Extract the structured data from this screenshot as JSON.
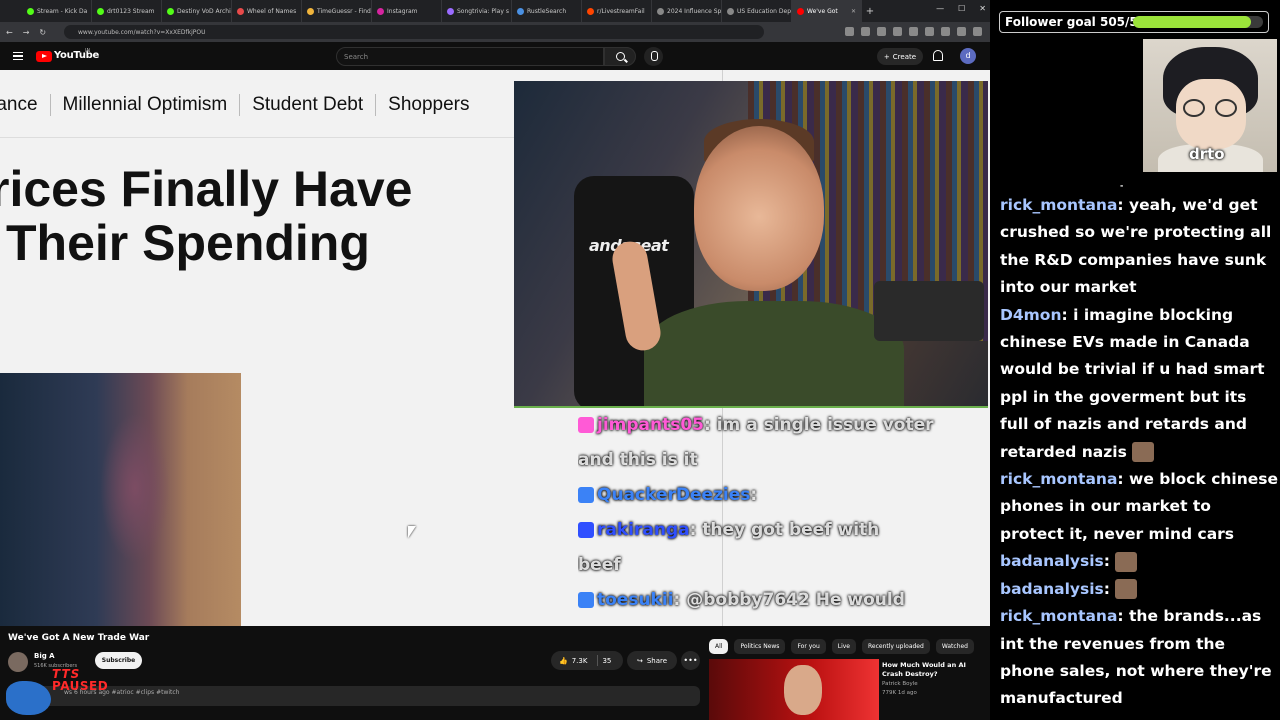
{
  "browser": {
    "tabs": [
      {
        "label": "Stream - Kick Da",
        "color": "#53fc18"
      },
      {
        "label": "drt0123 Stream",
        "color": "#53fc18"
      },
      {
        "label": "Destiny VoD Archi",
        "color": "#53fc18"
      },
      {
        "label": "Wheel of Names",
        "color": "#e84a4a"
      },
      {
        "label": "TimeGuessr - Find",
        "color": "#f0b43c"
      },
      {
        "label": "Instagram",
        "color": "#d6249f"
      },
      {
        "label": "Songtrivia: Play s",
        "color": "#9a6bff"
      },
      {
        "label": "RustleSearch",
        "color": "#4a90e2"
      },
      {
        "label": "r/LivestreamFail",
        "color": "#ff4500"
      },
      {
        "label": "2024 Influence Spendi",
        "color": "#888888"
      },
      {
        "label": "US Education Dep",
        "color": "#888888"
      },
      {
        "label": "We've Got",
        "color": "#ff0000",
        "active": true
      }
    ],
    "url": "www.youtube.com/watch?v=XxXEDfkjPOU"
  },
  "youtube": {
    "logo": "YouTube",
    "logo_sup": "IN",
    "search_placeholder": "Search",
    "create_label": "Create",
    "avatar_letter": "d"
  },
  "video": {
    "nav": [
      "rance",
      "Millennial Optimism",
      "Student Debt",
      "Shoppers"
    ],
    "headline": [
      "rices Finally Have",
      "Their Spending"
    ],
    "chair_brand": "andaseat",
    "overlay_chat": [
      {
        "user": "jimpants05",
        "user_color": "#ff5ad6",
        "text": ": im a single issue voter"
      },
      {
        "user": "",
        "user_color": "",
        "text": "and this is it"
      },
      {
        "user": "QuackerDeezies",
        "user_color": "#3b82f6",
        "text": ":"
      },
      {
        "user": "rakiranga",
        "user_color": "#2f4fff",
        "text": ": they got beef with"
      },
      {
        "user": "",
        "user_color": "",
        "text": "beef"
      },
      {
        "user": "toesukii",
        "user_color": "#3b82f6",
        "text": ": @bobby7642 He would"
      }
    ]
  },
  "info": {
    "title": "We've Got A New Trade War",
    "channel": "Big A",
    "subscribers": "516K subscribers",
    "subscribe_label": "Subscribe",
    "likes": "7.3K",
    "comments": "35",
    "share_label": "Share",
    "more_label": "•••",
    "desc": "ws  6 hours ago  #atrioc #clips #twitch",
    "tts_line1": "TTS",
    "tts_line2": "PAUSED",
    "chips": [
      "All",
      "Politics News",
      "For you",
      "Live",
      "Recently uploaded",
      "Watched"
    ],
    "rec": {
      "title": "How Much Would an AI Crash Destroy?",
      "channel": "Patrick Boyle",
      "meta": "779K  1d ago"
    }
  },
  "sidebar": {
    "goal_label": "Follower goal 505/555",
    "goal_progress": 0.91,
    "avatar_name": "drto",
    "chat": [
      {
        "user": "",
        "text": "-"
      },
      {
        "user": "rick_montana",
        "text": "yeah, we'd get crushed so we're protecting all the R&D companies have sunk into our market"
      },
      {
        "user": "D4mon",
        "text": "i imagine blocking chinese EVs made in Canada would be trivial if u had smart ppl in the goverment but its full of nazis and retards and retarded nazis",
        "emote": true
      },
      {
        "user": "rick_montana",
        "text": "we block chinese phones in our market to protect it, never mind cars"
      },
      {
        "user": "badanalysis",
        "text": "",
        "emote": true
      },
      {
        "user": "badanalysis",
        "text": "",
        "emote": true
      },
      {
        "user": "rick_montana",
        "text": "the brands...as int the revenues from the phone sales, not where they're manufactured"
      }
    ]
  }
}
